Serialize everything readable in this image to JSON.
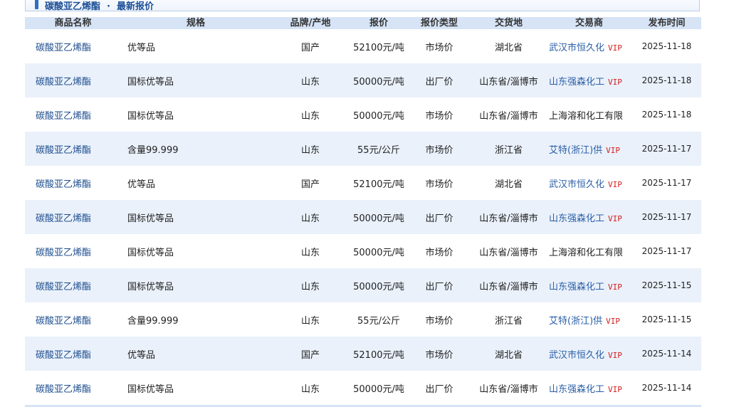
{
  "panel": {
    "title": "碳酸亚乙烯酯",
    "separator": "·",
    "subtitle": "最新报价"
  },
  "table": {
    "headers": [
      "商品名称",
      "规格",
      "品牌/产地",
      "报价",
      "报价类型",
      "交货地",
      "交易商",
      "发布时间"
    ],
    "rows": [
      {
        "name": "碳酸亚乙烯酯",
        "spec": "优等品",
        "brand": "国产",
        "price": "52100元/吨",
        "price_type": "市场价",
        "delivery": "湖北省",
        "trader": "武汉市恒久化",
        "vip": "VIP",
        "date": "2025-11-18"
      },
      {
        "name": "碳酸亚乙烯酯",
        "spec": "国标优等品",
        "brand": "山东",
        "price": "50000元/吨",
        "price_type": "出厂价",
        "delivery": "山东省/淄博市",
        "trader": "山东强森化工",
        "vip": "VIP",
        "date": "2025-11-18"
      },
      {
        "name": "碳酸亚乙烯酯",
        "spec": "国标优等品",
        "brand": "山东",
        "price": "50000元/吨",
        "price_type": "市场价",
        "delivery": "山东省/淄博市",
        "trader": "上海溶和化工有限",
        "vip": "",
        "date": "2025-11-18"
      },
      {
        "name": "碳酸亚乙烯酯",
        "spec": "含量99.999",
        "brand": "山东",
        "price": "55元/公斤",
        "price_type": "市场价",
        "delivery": "浙江省",
        "trader": "艾特(浙江)供",
        "vip": "VIP",
        "date": "2025-11-17"
      },
      {
        "name": "碳酸亚乙烯酯",
        "spec": "优等品",
        "brand": "国产",
        "price": "52100元/吨",
        "price_type": "市场价",
        "delivery": "湖北省",
        "trader": "武汉市恒久化",
        "vip": "VIP",
        "date": "2025-11-17"
      },
      {
        "name": "碳酸亚乙烯酯",
        "spec": "国标优等品",
        "brand": "山东",
        "price": "50000元/吨",
        "price_type": "出厂价",
        "delivery": "山东省/淄博市",
        "trader": "山东强森化工",
        "vip": "VIP",
        "date": "2025-11-17"
      },
      {
        "name": "碳酸亚乙烯酯",
        "spec": "国标优等品",
        "brand": "山东",
        "price": "50000元/吨",
        "price_type": "市场价",
        "delivery": "山东省/淄博市",
        "trader": "上海溶和化工有限",
        "vip": "",
        "date": "2025-11-17"
      },
      {
        "name": "碳酸亚乙烯酯",
        "spec": "国标优等品",
        "brand": "山东",
        "price": "50000元/吨",
        "price_type": "出厂价",
        "delivery": "山东省/淄博市",
        "trader": "山东强森化工",
        "vip": "VIP",
        "date": "2025-11-15"
      },
      {
        "name": "碳酸亚乙烯酯",
        "spec": "含量99.999",
        "brand": "山东",
        "price": "55元/公斤",
        "price_type": "市场价",
        "delivery": "浙江省",
        "trader": "艾特(浙江)供",
        "vip": "VIP",
        "date": "2025-11-15"
      },
      {
        "name": "碳酸亚乙烯酯",
        "spec": "优等品",
        "brand": "国产",
        "price": "52100元/吨",
        "price_type": "市场价",
        "delivery": "湖北省",
        "trader": "武汉市恒久化",
        "vip": "VIP",
        "date": "2025-11-14"
      },
      {
        "name": "碳酸亚乙烯酯",
        "spec": "国标优等品",
        "brand": "山东",
        "price": "50000元/吨",
        "price_type": "出厂价",
        "delivery": "山东省/淄博市",
        "trader": "山东强森化工",
        "vip": "VIP",
        "date": "2025-11-14"
      }
    ]
  }
}
